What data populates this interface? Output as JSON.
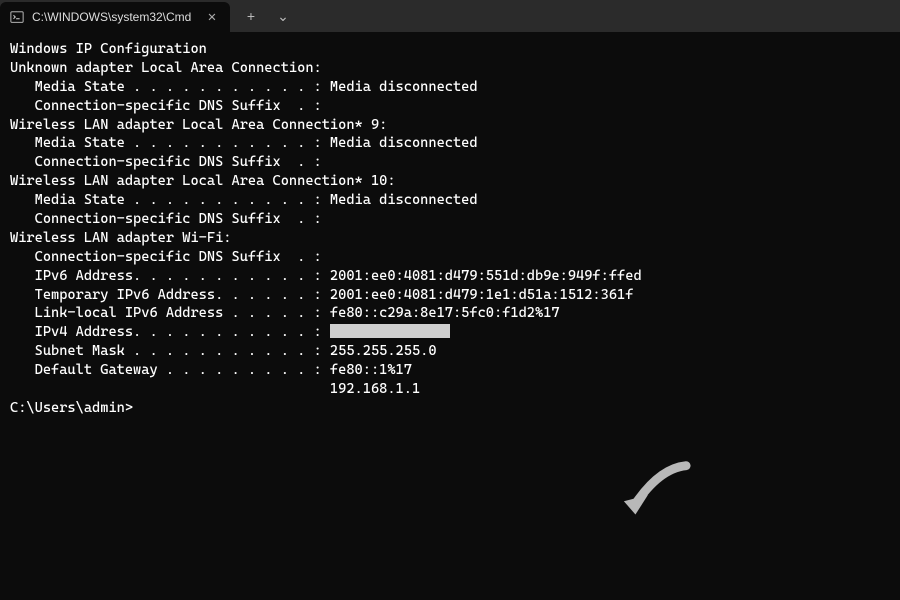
{
  "titlebar": {
    "tab_title": "C:\\WINDOWS\\system32\\Cmd",
    "new_tab_label": "+",
    "dropdown_label": "⌄"
  },
  "output": {
    "header": "Windows IP Configuration",
    "adapters": [
      {
        "title": "Unknown adapter Local Area Connection:",
        "lines": [
          {
            "label": "   Media State . . . . . . . . . . . :",
            "value": " Media disconnected"
          },
          {
            "label": "   Connection-specific DNS Suffix  . :",
            "value": ""
          }
        ]
      },
      {
        "title": "Wireless LAN adapter Local Area Connection* 9:",
        "lines": [
          {
            "label": "   Media State . . . . . . . . . . . :",
            "value": " Media disconnected"
          },
          {
            "label": "   Connection-specific DNS Suffix  . :",
            "value": ""
          }
        ]
      },
      {
        "title": "Wireless LAN adapter Local Area Connection* 10:",
        "lines": [
          {
            "label": "   Media State . . . . . . . . . . . :",
            "value": " Media disconnected"
          },
          {
            "label": "   Connection-specific DNS Suffix  . :",
            "value": ""
          }
        ]
      },
      {
        "title": "Wireless LAN adapter Wi-Fi:",
        "lines": [
          {
            "label": "   Connection-specific DNS Suffix  . :",
            "value": ""
          },
          {
            "label": "   IPv6 Address. . . . . . . . . . . :",
            "value": " 2001:ee0:4081:d479:551d:db9e:949f:ffed"
          },
          {
            "label": "   Temporary IPv6 Address. . . . . . :",
            "value": " 2001:ee0:4081:d479:1e1:d51a:1512:361f"
          },
          {
            "label": "   Link-local IPv6 Address . . . . . :",
            "value": " fe80::c29a:8e17:5fc0:f1d2%17"
          },
          {
            "label": "   IPv4 Address. . . . . . . . . . . :",
            "value": " ",
            "redacted": true
          },
          {
            "label": "   Subnet Mask . . . . . . . . . . . :",
            "value": " 255.255.255.0"
          },
          {
            "label": "   Default Gateway . . . . . . . . . :",
            "value": " fe80::1%17"
          },
          {
            "label": "                                      ",
            "value": " 192.168.1.1"
          }
        ]
      }
    ],
    "prompt": "C:\\Users\\admin>"
  }
}
